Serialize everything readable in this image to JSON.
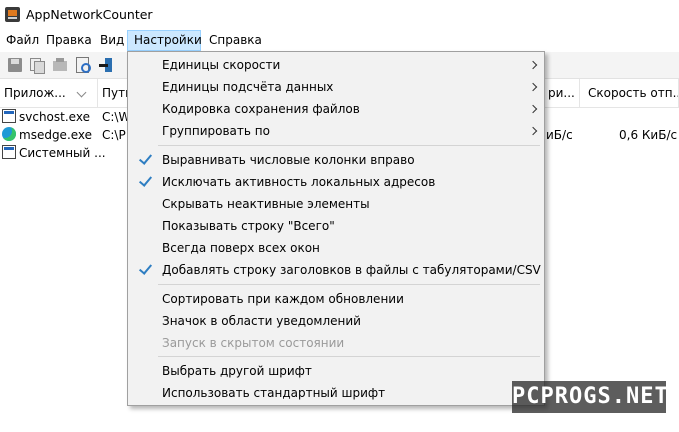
{
  "window": {
    "title": "AppNetworkCounter"
  },
  "menubar": [
    "Файл",
    "Правка",
    "Вид",
    "Настройки",
    "Справка"
  ],
  "toolbar": {
    "icons": [
      "save-icon",
      "copy-icon",
      "properties-icon",
      "find-icon",
      "exit-icon"
    ]
  },
  "columns": {
    "app": "Прилож...",
    "path": "Путь",
    "c2": "ри...",
    "c3": "Скорость отп..."
  },
  "rows": [
    {
      "name": "svchost.exe",
      "path": "C:\\W",
      "c2": "",
      "c3": ""
    },
    {
      "name": "msedge.exe",
      "path": "C:\\P",
      "c2": "иБ/с",
      "c3": "0,6 КиБ/с"
    },
    {
      "name": "Системный ...",
      "path": "",
      "c2": "",
      "c3": ""
    }
  ],
  "menu": [
    "Единицы скорости",
    "Единицы подсчёта данных",
    "Кодировка сохранения файлов",
    "Группировать по",
    "Выравнивать числовые колонки вправо",
    "Исключать активность локальных адресов",
    "Скрывать неактивные элементы",
    "Показывать строку \"Всего\"",
    "Всегда поверх всех окон",
    "Добавлять строку заголовков в файлы с табуляторами/CSV",
    "Сортировать при каждом обновлении",
    "Значок в области уведомлений",
    "Запуск в скрытом состоянии",
    "Выбрать другой шрифт",
    "Использовать стандартный шрифт"
  ],
  "menu_state": {
    "submenu_items": [
      "Единицы скорости",
      "Единицы подсчёта данных",
      "Кодировка сохранения файлов",
      "Группировать по"
    ],
    "checked_items": [
      "Выравнивать числовые колонки вправо",
      "Исключать активность локальных адресов",
      "Добавлять строку заголовков в файлы с табуляторами/CSV"
    ],
    "disabled_items": [
      "Запуск в скрытом состоянии"
    ]
  },
  "watermark": "PCPROGS.NET",
  "colors": {
    "active_menu_bg": "#cce8ff",
    "check": "#2e7ec2",
    "menu_bg": "#f2f2f2"
  }
}
